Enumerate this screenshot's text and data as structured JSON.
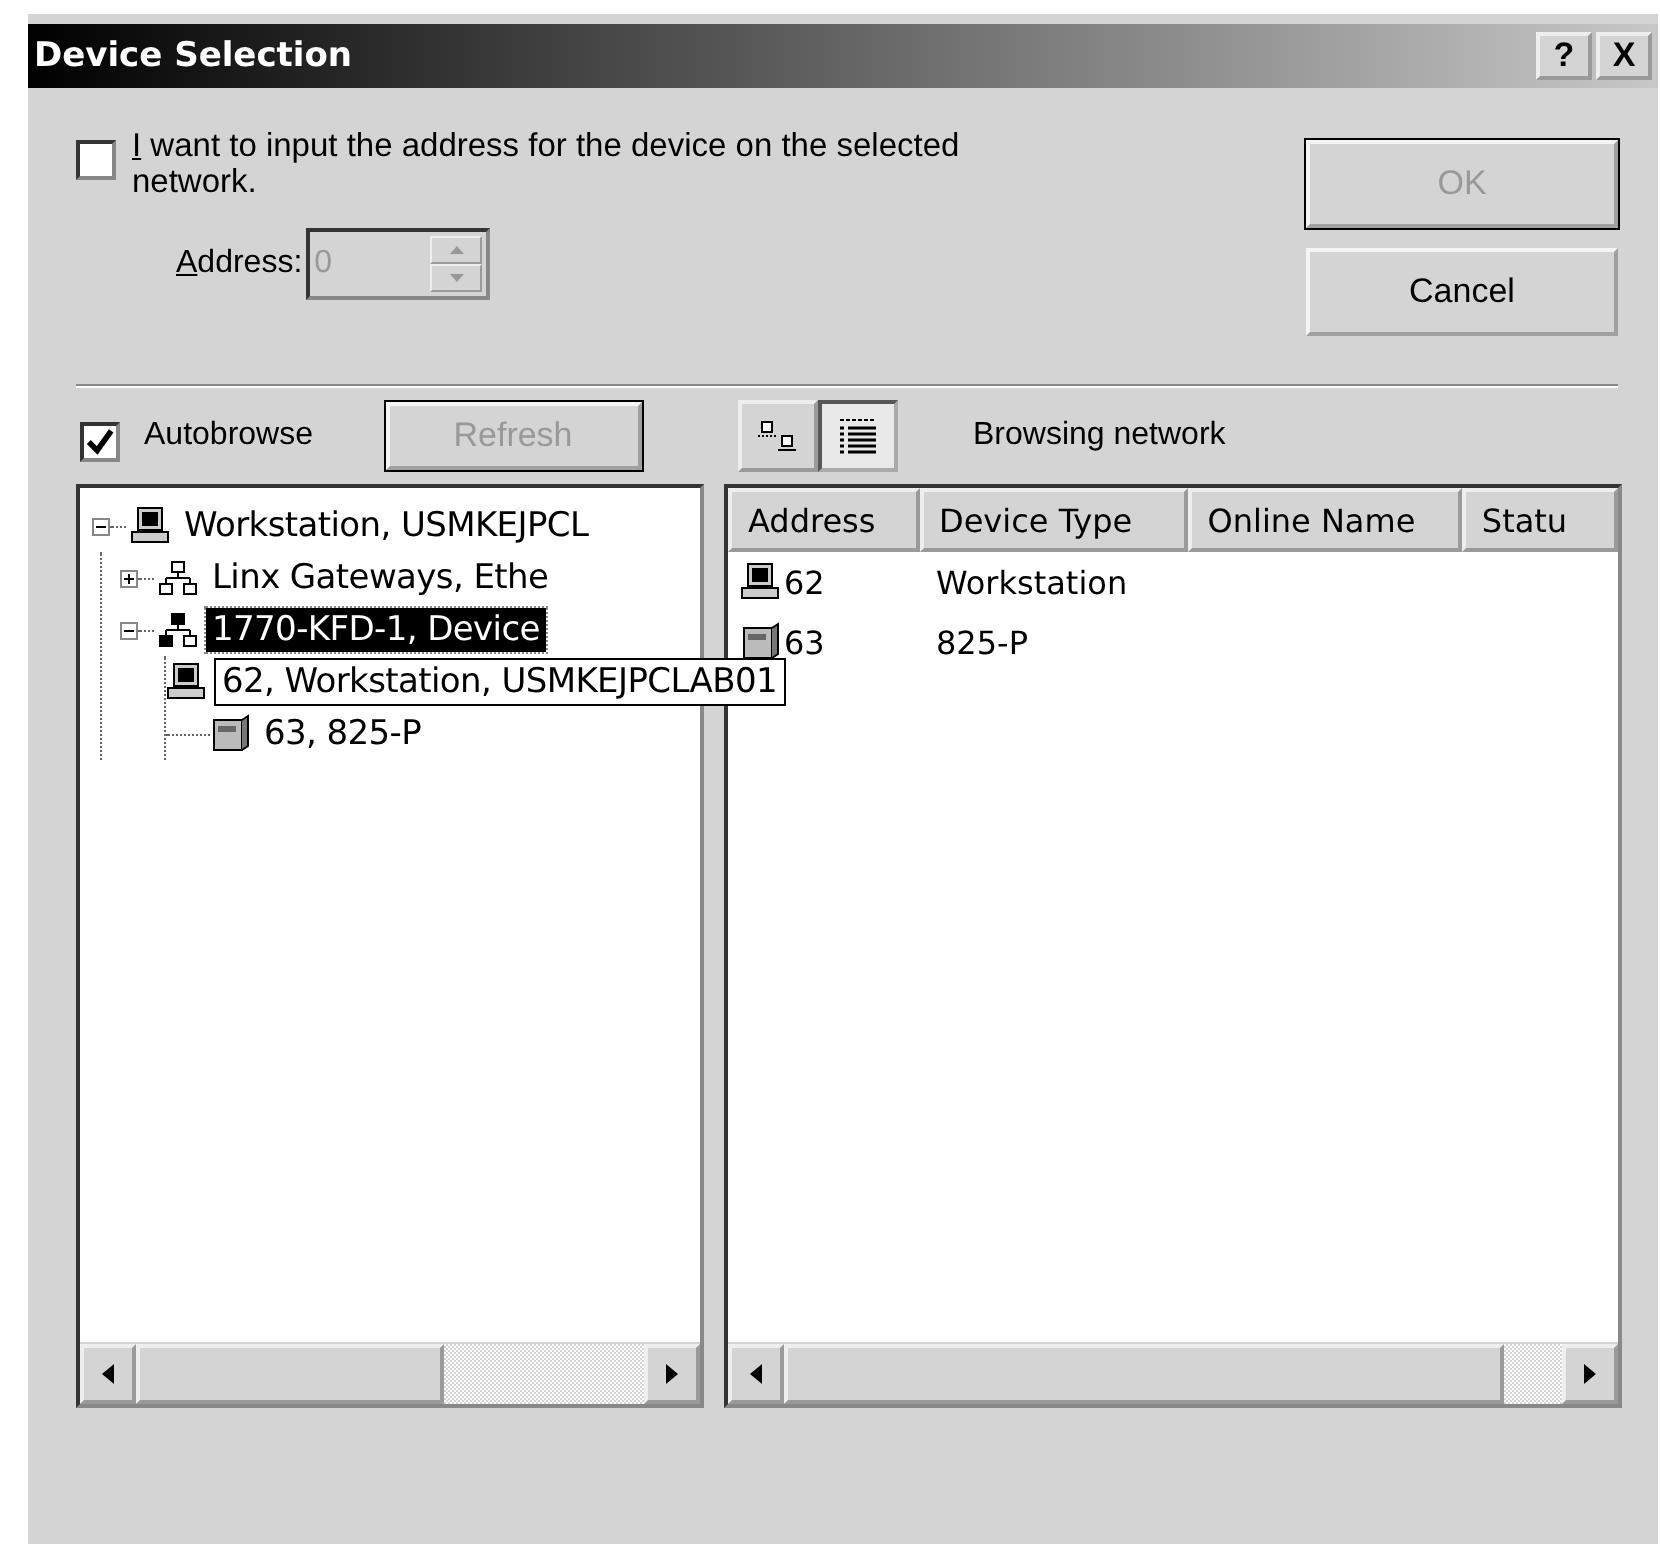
{
  "window": {
    "title": "Device Selection",
    "title_buttons": [
      "?",
      "X"
    ]
  },
  "address_option": {
    "label": "I want to input the address for the device on the selected network.",
    "checked": false
  },
  "address": {
    "label": "Address:",
    "value": "0",
    "disabled": true
  },
  "buttons": [
    {
      "label": "OK",
      "disabled": true
    },
    {
      "label": "Cancel",
      "disabled": false
    }
  ],
  "autobrowse": {
    "label": "Autobrowse",
    "checked": true
  },
  "refresh": {
    "label": "Refresh",
    "disabled": true
  },
  "view_buttons": [
    {
      "kind": "icons",
      "selected": false
    },
    {
      "kind": "details",
      "selected": true
    }
  ],
  "status": "Browsing network",
  "tree": [
    {
      "label": "Workstation, USMKEJPCL",
      "kind": "computer",
      "expanded": true,
      "selected": false,
      "children": [
        {
          "label": "Linx Gateways, Ethe",
          "kind": "network",
          "expanded": false,
          "selected": false
        },
        {
          "label": "1770-KFD-1, Device",
          "kind": "network",
          "expanded": true,
          "selected": true,
          "children": [
            {
              "label": "62, Workstation, USMKEJPCLAB01",
              "kind": "computer",
              "tooltip": true,
              "selected": false
            },
            {
              "label": "63, 825-P",
              "kind": "device",
              "tooltip": false,
              "selected": false
            }
          ]
        }
      ]
    }
  ],
  "table": {
    "columns": [
      "Address",
      "Device Type",
      "Online Name",
      "Statu"
    ],
    "rows": [
      {
        "kind": "computer",
        "cells": [
          "62",
          "Workstation"
        ]
      },
      {
        "kind": "device",
        "cells": [
          "63",
          "825-P"
        ]
      }
    ]
  }
}
